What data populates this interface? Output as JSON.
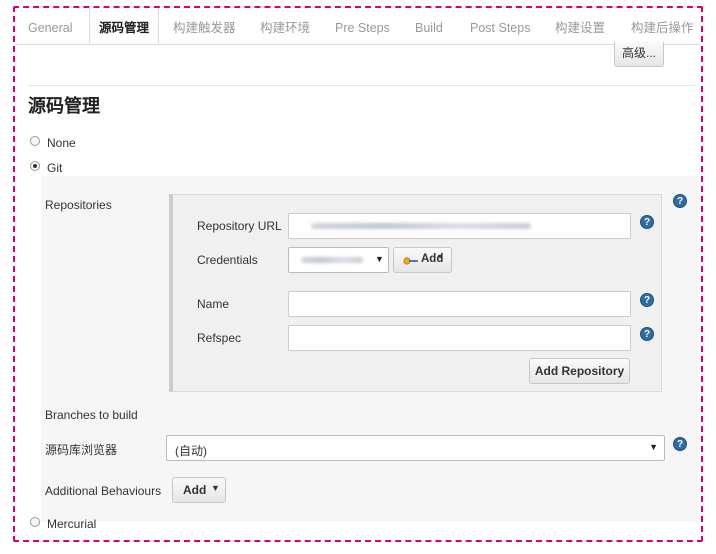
{
  "tabs": [
    {
      "label": "General"
    },
    {
      "label": "源码管理"
    },
    {
      "label": "构建触发器"
    },
    {
      "label": "构建环境"
    },
    {
      "label": "Pre Steps"
    },
    {
      "label": "Build"
    },
    {
      "label": "Post Steps"
    },
    {
      "label": "构建设置"
    },
    {
      "label": "构建后操作"
    }
  ],
  "advanced_label": "高级...",
  "section_title": "源码管理",
  "scm_options": {
    "none": "None",
    "git": "Git",
    "mercurial": "Mercurial"
  },
  "selected_scm": "Git",
  "repositories": {
    "label": "Repositories",
    "url_label": "Repository URL",
    "credentials_label": "Credentials",
    "add_credential_label": "Add",
    "name_label": "Name",
    "refspec_label": "Refspec",
    "add_repository_label": "Add Repository"
  },
  "branches_label": "Branches to build",
  "browser": {
    "label": "源码库浏览器",
    "selected": "(自动)"
  },
  "behaviours": {
    "label": "Additional Behaviours",
    "add_label": "Add"
  },
  "help_glyph": "?",
  "colors": {
    "frame_border": "#d6007a",
    "help_icon": "#2f6ca3",
    "key_icon": "#f0a81c"
  }
}
